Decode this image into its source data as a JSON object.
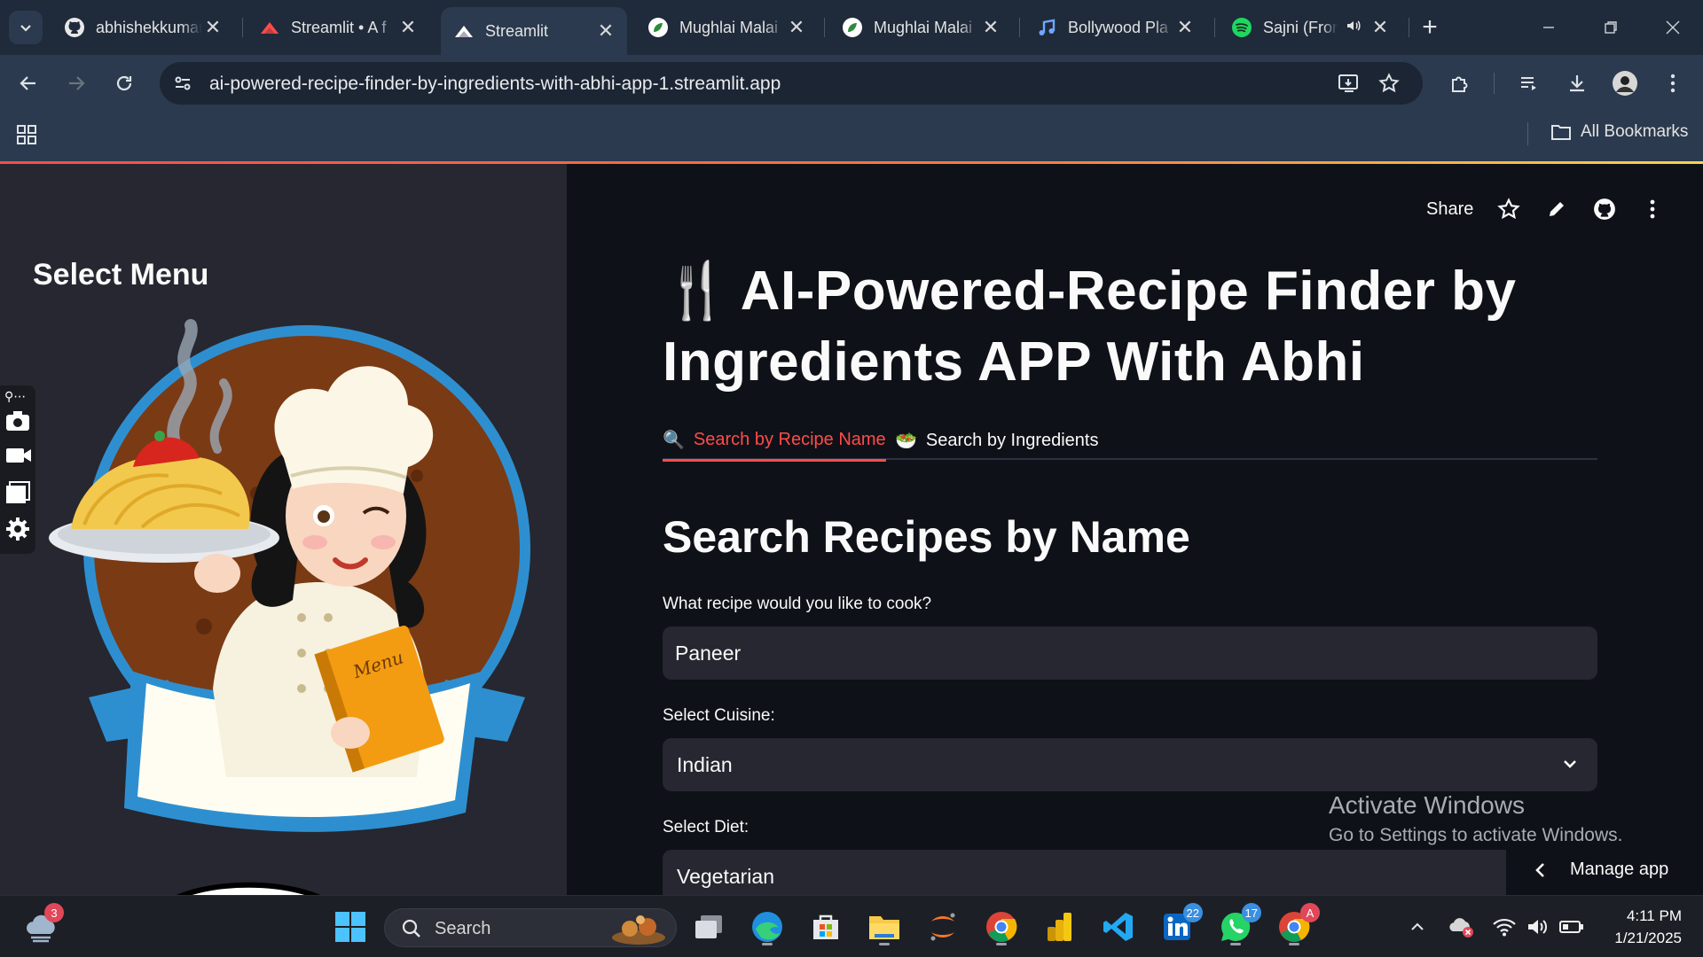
{
  "browser": {
    "tabs": [
      {
        "title": "abhishekkumar",
        "icon": "github-icon"
      },
      {
        "title": "Streamlit • A f",
        "icon": "streamlit-icon"
      },
      {
        "title": "Streamlit",
        "icon": "streamlit-icon",
        "active": true
      },
      {
        "title": "Mughlai Malai",
        "icon": "leaf-icon"
      },
      {
        "title": "Mughlai Malai",
        "icon": "leaf-icon"
      },
      {
        "title": "Bollywood Pla",
        "icon": "music-note-icon"
      },
      {
        "title": "Sajni (From",
        "icon": "spotify-icon",
        "audio": true
      }
    ],
    "url": "ai-powered-recipe-finder-by-ingredients-with-abhi-app-1.streamlit.app",
    "bookmarks_label": "All Bookmarks"
  },
  "sidebar": {
    "title": "Select Menu",
    "image_caption_word": "Menu"
  },
  "header": {
    "share_label": "Share"
  },
  "main": {
    "title_emoji": "🍴",
    "title": "AI-Powered-Recipe Finder by Ingredients APP With Abhi",
    "tabs": [
      {
        "emoji": "🔍",
        "label": "Search by Recipe Name",
        "active": true
      },
      {
        "emoji": "🥗",
        "label": "Search by Ingredients",
        "active": false
      }
    ],
    "section_heading": "Search Recipes by Name",
    "recipe_label": "What recipe would you like to cook?",
    "recipe_value": "Paneer",
    "cuisine_label": "Select Cuisine:",
    "cuisine_value": "Indian",
    "diet_label": "Select Diet:",
    "diet_value": "Vegetarian"
  },
  "overlay": {
    "activate_line1": "Activate Windows",
    "activate_line2": "Go to Settings to activate Windows.",
    "manage_app": "Manage app"
  },
  "taskbar": {
    "weather_badge": "3",
    "search_label": "Search",
    "linkedin_badge": "22",
    "whatsapp_badge": "17",
    "chrome_badge": "A",
    "time": "4:11 PM",
    "date": "1/21/2025"
  },
  "colors": {
    "accent": "#ff4b4b",
    "sidebar_bg": "#262730",
    "main_bg": "#0e1117",
    "input_bg": "#262730"
  }
}
